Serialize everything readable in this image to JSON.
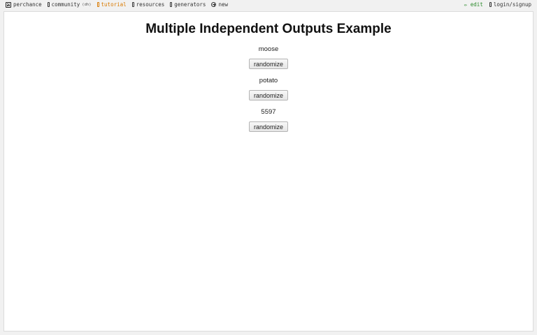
{
  "nav": {
    "brand": "perchance",
    "community": "community",
    "community_suffix": "(dh)",
    "tutorial": "tutorial",
    "resources": "resources",
    "generators": "generators",
    "new": "new",
    "edit": "✏ edit",
    "login": "login/signup"
  },
  "page": {
    "title": "Multiple Independent Outputs Example"
  },
  "outputs": [
    {
      "value": "moose",
      "button": "randomize"
    },
    {
      "value": "potato",
      "button": "randomize"
    },
    {
      "value": "5597",
      "button": "randomize"
    }
  ],
  "colors": {
    "tutorial_accent": "#d97a00",
    "edit_accent": "#2b8a2b"
  }
}
